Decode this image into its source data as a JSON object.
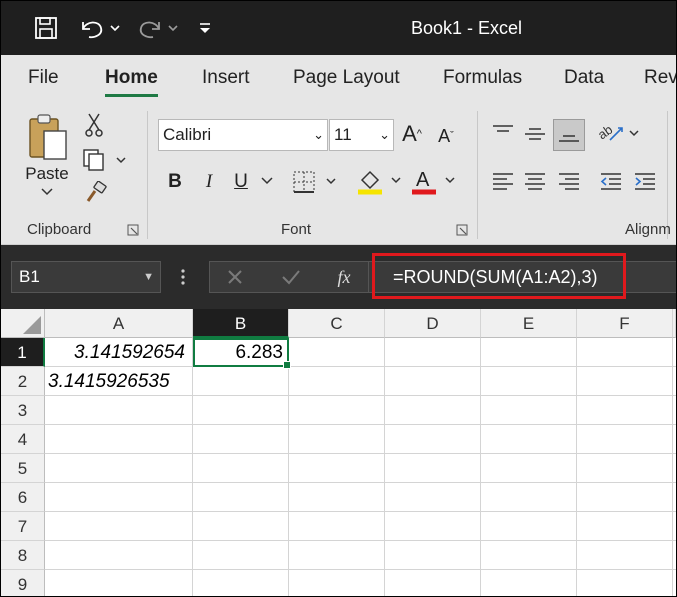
{
  "window": {
    "title": "Book1  -  Excel"
  },
  "ribbon_tabs": [
    "File",
    "Home",
    "Insert",
    "Page Layout",
    "Formulas",
    "Data",
    "Rev"
  ],
  "clipboard": {
    "paste_label": "Paste",
    "group_label": "Clipboard"
  },
  "font": {
    "name": "Calibri",
    "size": "11",
    "group_label": "Font",
    "bold": "B",
    "italic": "I",
    "underline": "U"
  },
  "alignment": {
    "group_label": "Alignm"
  },
  "formula_bar": {
    "name_box": "B1",
    "fx": "fx",
    "formula": "=ROUND(SUM(A1:A2),3)"
  },
  "grid": {
    "columns": [
      "A",
      "B",
      "C",
      "D",
      "E",
      "F"
    ],
    "rows": [
      "1",
      "2",
      "3",
      "4",
      "5",
      "6",
      "7",
      "8",
      "9"
    ],
    "cells": {
      "A1": "3.141592654",
      "B1": "6.283",
      "A2": "3.1415926535"
    }
  },
  "colors": {
    "accent": "#107c41",
    "highlight": "#e0191d",
    "title_bg": "#1f1f1f",
    "ribbon_bg": "#e6e6e6"
  }
}
